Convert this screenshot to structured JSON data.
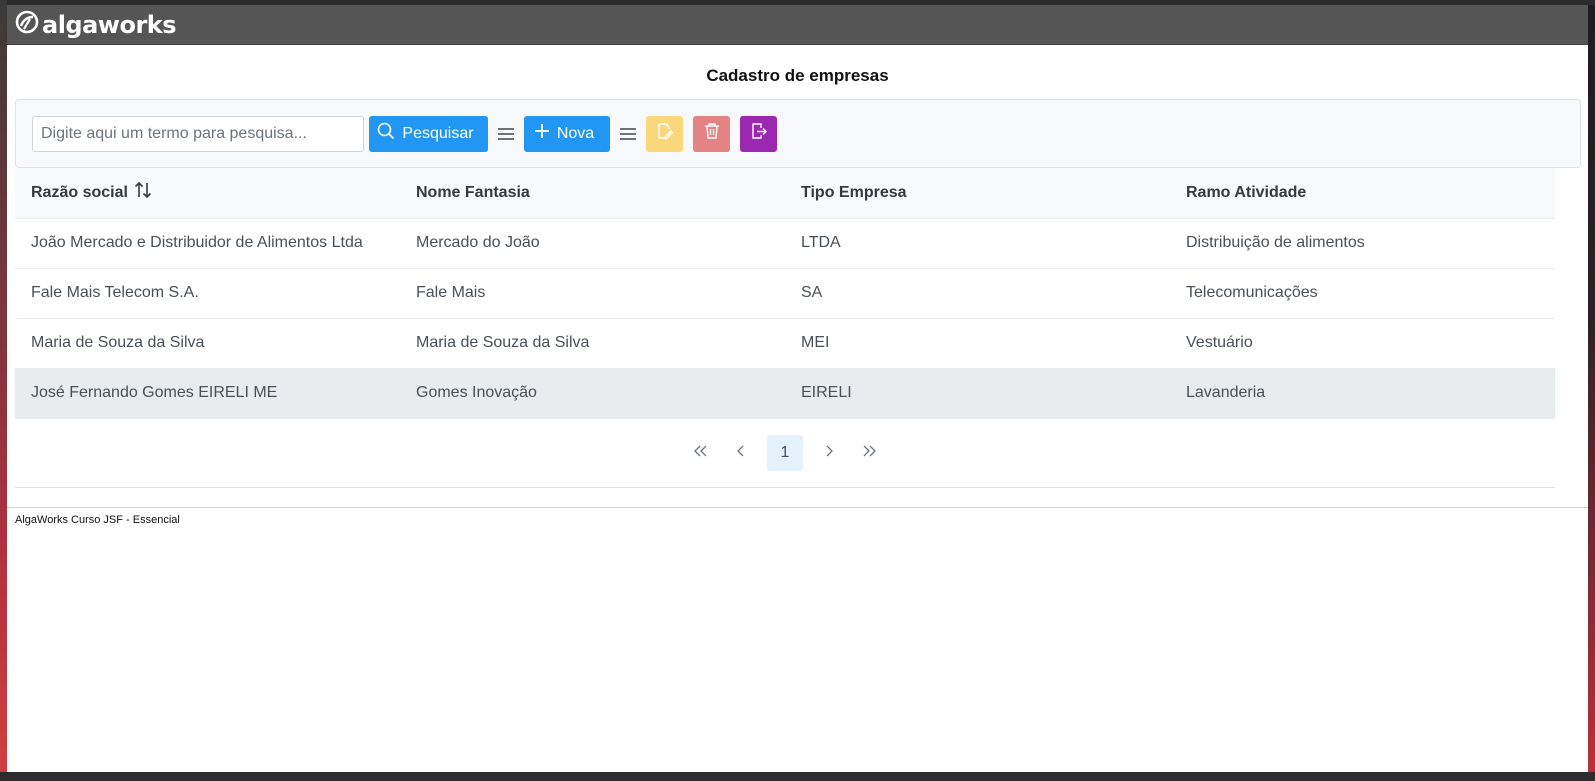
{
  "brand": {
    "logo_text": "algaworks"
  },
  "page": {
    "title": "Cadastro de empresas"
  },
  "toolbar": {
    "search_placeholder": "Digite aqui um termo para pesquisa...",
    "search_label": "Pesquisar",
    "new_label": "Nova",
    "colors": {
      "primary": "#2196f3",
      "edit": "#fbd77c",
      "delete": "#e38383",
      "export": "#9c27b0"
    }
  },
  "table": {
    "headers": [
      "Razão social",
      "Nome Fantasia",
      "Tipo Empresa",
      "Ramo Atividade"
    ],
    "sort_icon": "sort-icon",
    "rows": [
      [
        "João Mercado e Distribuidor de Alimentos Ltda",
        "Mercado do João",
        "LTDA",
        "Distribuição de alimentos"
      ],
      [
        "Fale Mais Telecom S.A.",
        "Fale Mais",
        "SA",
        "Telecomunicações"
      ],
      [
        "Maria de Souza da Silva",
        "Maria de Souza da Silva",
        "MEI",
        "Vestuário"
      ],
      [
        "José Fernando Gomes EIRELI ME",
        "Gomes Inovação",
        "EIRELI",
        "Lavanderia"
      ]
    ]
  },
  "paginator": {
    "current_page": "1"
  },
  "footer": {
    "text": "AlgaWorks Curso JSF - Essencial"
  }
}
